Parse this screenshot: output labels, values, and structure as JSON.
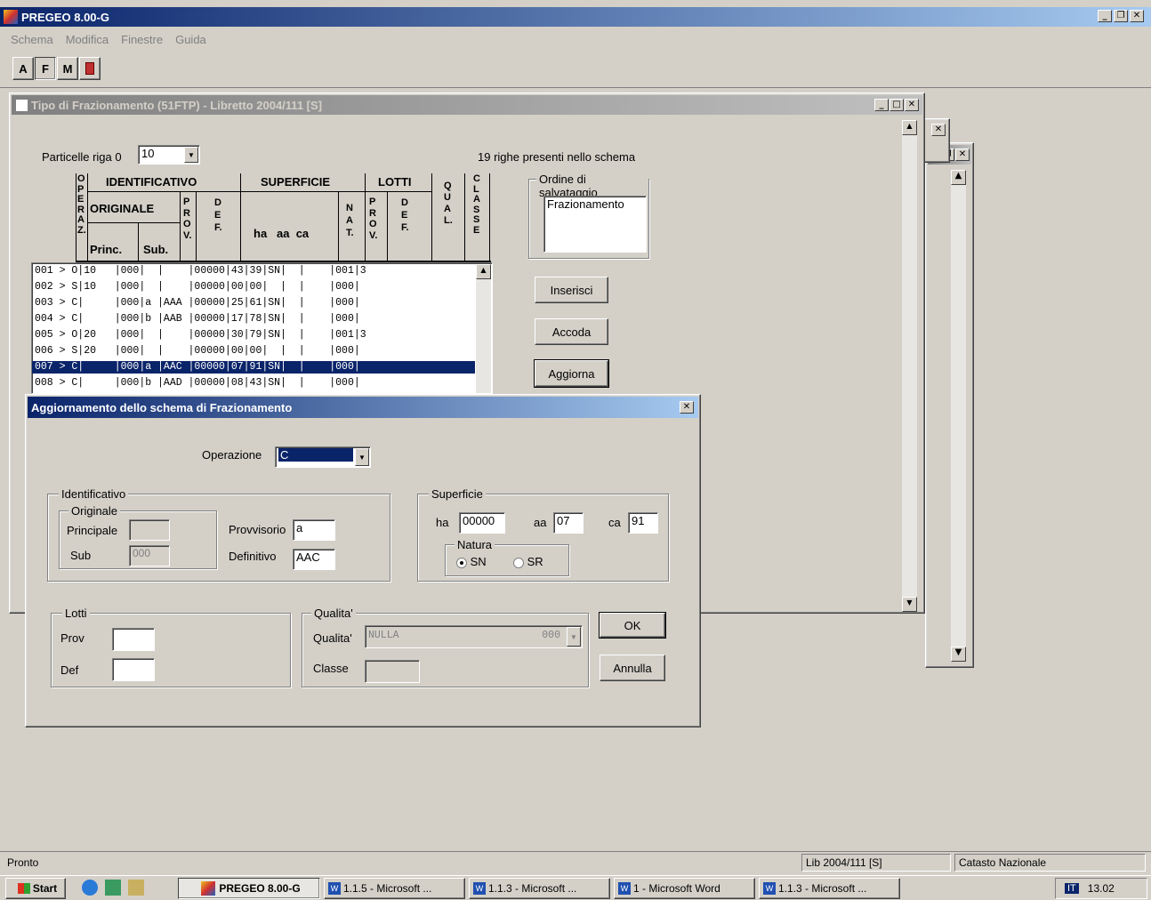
{
  "app": {
    "title": "PREGEO 8.00-G"
  },
  "menu": [
    "Schema",
    "Modifica",
    "Finestre",
    "Guida"
  ],
  "toolbar": [
    "A",
    "F",
    "M"
  ],
  "frazwin": {
    "title": "Tipo di Frazionamento (51FTP) - Libretto 2004/111 [S]",
    "particelle_label": "Particelle riga 0",
    "particelle_value": "10",
    "righe_info": "19 righe presenti nello schema",
    "ordine_label": "Ordine di salvataggio",
    "ordine_items": [
      "Frazionamento"
    ],
    "buttons": {
      "inserisci": "Inserisci",
      "accoda": "Accoda",
      "aggiorna": "Aggiorna"
    },
    "headers": {
      "operaz": "O\nP\nE\nR\nA\nZ.",
      "identificativo": "IDENTIFICATIVO",
      "originale": "ORIGINALE",
      "princ": "Princ.",
      "sub": "Sub.",
      "prov": "P\nR\nO\nV.",
      "def": "D\nE\nF.",
      "superficie": "SUPERFICIE",
      "ha_aa_ca": "ha   aa  ca",
      "nat": "N\nA\nT.",
      "lotti": "LOTTI",
      "lprov": "P\nR\nO\nV.",
      "ldef": "D\nE\nF.",
      "qual": "Q\nU\nA\nL.",
      "classe": "C\nL\nA\nS\nS\nE"
    },
    "rows": [
      "001 > O|10   |000|  |    |00000|43|39|SN|  |    |001|3",
      "002 > S|10   |000|  |    |00000|00|00|  |  |    |000|",
      "003 > C|     |000|a |AAA |00000|25|61|SN|  |    |000|",
      "004 > C|     |000|b |AAB |00000|17|78|SN|  |    |000|",
      "005 > O|20   |000|  |    |00000|30|79|SN|  |    |001|3",
      "006 > S|20   |000|  |    |00000|00|00|  |  |    |000|",
      "007 > C|     |000|a |AAC |00000|07|91|SN|  |    |000|",
      "008 > C|     |000|b |AAD |00000|08|43|SN|  |    |000|"
    ],
    "selected_row": 6
  },
  "dialog": {
    "title": "Aggiornamento dello schema di Frazionamento",
    "operazione_label": "Operazione",
    "operazione_value": "C",
    "identificativo": {
      "group": "Identificativo",
      "originale_group": "Originale",
      "principale_label": "Principale",
      "principale_value": "",
      "sub_label": "Sub",
      "sub_value": "000",
      "provvisorio_label": "Provvisorio",
      "provvisorio_value": "a",
      "definitivo_label": "Definitivo",
      "definitivo_value": "AAC"
    },
    "superficie": {
      "group": "Superficie",
      "ha_label": "ha",
      "ha_value": "00000",
      "aa_label": "aa",
      "aa_value": "07",
      "ca_label": "ca",
      "ca_value": "91",
      "natura_group": "Natura",
      "sn_label": "SN",
      "sr_label": "SR",
      "selected": "SN"
    },
    "lotti": {
      "group": "Lotti",
      "prov_label": "Prov",
      "prov_value": "",
      "def_label": "Def",
      "def_value": ""
    },
    "qualita": {
      "group": "Qualita'",
      "qualita_label": "Qualita'",
      "qualita_value": "NULLA",
      "qualita_code": "000",
      "classe_label": "Classe",
      "classe_value": ""
    },
    "ok_label": "OK",
    "annulla_label": "Annulla"
  },
  "statusbar": {
    "left": "Pronto",
    "lib": "Lib 2004/111 [S]",
    "catasto": "Catasto Nazionale"
  },
  "taskbar": {
    "start": "Start",
    "items": [
      "PREGEO 8.00-G",
      "1.1.5 - Microsoft ...",
      "1.1.3 - Microsoft ...",
      "1 - Microsoft Word",
      "1.1.3 - Microsoft ..."
    ],
    "lang": "IT",
    "clock": "13.02"
  }
}
